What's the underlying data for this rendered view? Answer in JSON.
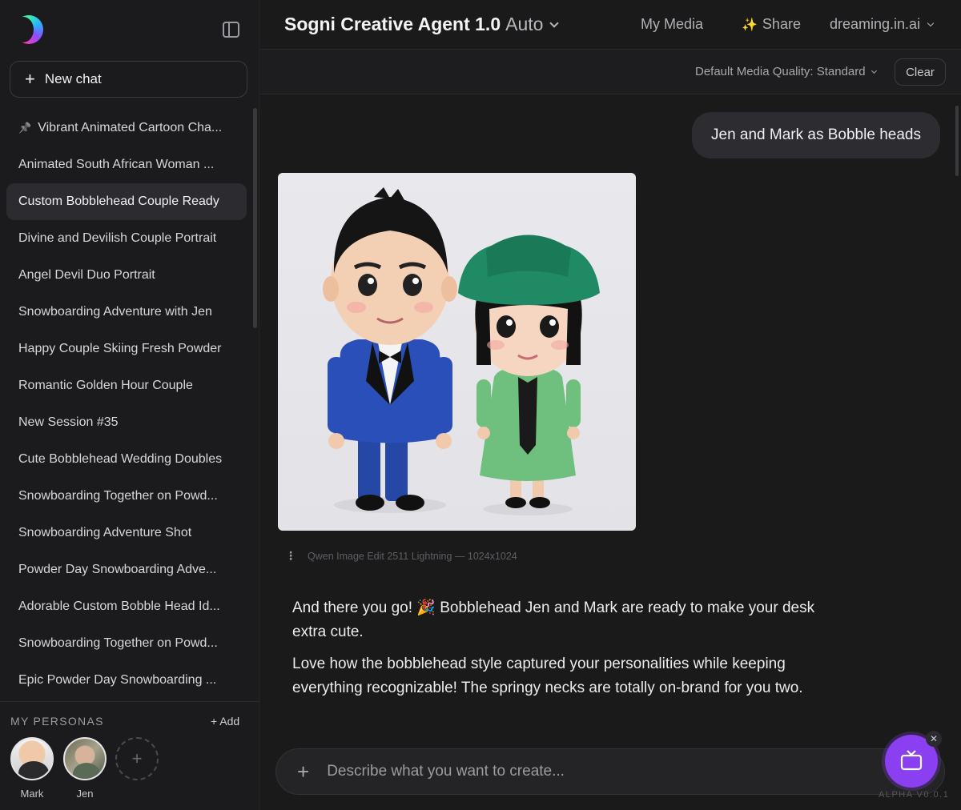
{
  "app": {
    "title": "Sogni Creative Agent 1.0",
    "mode": "Auto",
    "my_media": "My Media",
    "share": "Share",
    "account": "dreaming.in.ai"
  },
  "sidebar": {
    "new_chat": "New chat",
    "chats": [
      {
        "label": "Vibrant Animated Cartoon Cha...",
        "pinned": true,
        "active": false
      },
      {
        "label": "Animated South African Woman ...",
        "pinned": false,
        "active": false
      },
      {
        "label": "Custom Bobblehead Couple Ready",
        "pinned": false,
        "active": true
      },
      {
        "label": "Divine and Devilish Couple Portrait",
        "pinned": false,
        "active": false
      },
      {
        "label": "Angel Devil Duo Portrait",
        "pinned": false,
        "active": false
      },
      {
        "label": "Snowboarding Adventure with Jen",
        "pinned": false,
        "active": false
      },
      {
        "label": "Happy Couple Skiing Fresh Powder",
        "pinned": false,
        "active": false
      },
      {
        "label": "Romantic Golden Hour Couple",
        "pinned": false,
        "active": false
      },
      {
        "label": "New Session #35",
        "pinned": false,
        "active": false
      },
      {
        "label": "Cute Bobblehead Wedding Doubles",
        "pinned": false,
        "active": false
      },
      {
        "label": "Snowboarding Together on Powd...",
        "pinned": false,
        "active": false
      },
      {
        "label": "Snowboarding Adventure Shot",
        "pinned": false,
        "active": false
      },
      {
        "label": "Powder Day Snowboarding Adve...",
        "pinned": false,
        "active": false
      },
      {
        "label": "Adorable Custom Bobble Head Id...",
        "pinned": false,
        "active": false
      },
      {
        "label": "Snowboarding Together on Powd...",
        "pinned": false,
        "active": false
      },
      {
        "label": "Epic Powder Day Snowboarding ...",
        "pinned": false,
        "active": false
      }
    ],
    "personas_title": "MY PERSONAS",
    "add_persona": "+ Add",
    "personas": [
      {
        "name": "Mark"
      },
      {
        "name": "Jen"
      }
    ]
  },
  "toolbar": {
    "quality": "Default Media Quality: Standard",
    "clear": "Clear"
  },
  "conversation": {
    "user_message": "Jen and Mark as Bobble heads",
    "image_meta": "Qwen Image Edit 2511 Lightning — 1024x1024",
    "reply_1": "And there you go! 🎉 Bobblehead Jen and Mark are ready to make your desk extra cute.",
    "reply_2": "Love how the bobblehead style captured your personalities while keeping everything recognizable! The springy necks are totally on-brand for you two."
  },
  "composer": {
    "placeholder": "Describe what you want to create..."
  },
  "version": "ALPHA V0.0.1",
  "colors": {
    "background": "#1a1a1b",
    "sidebar": "#1b1b1d",
    "accent": "#8a3ff0",
    "active_item": "#2c2c30"
  }
}
